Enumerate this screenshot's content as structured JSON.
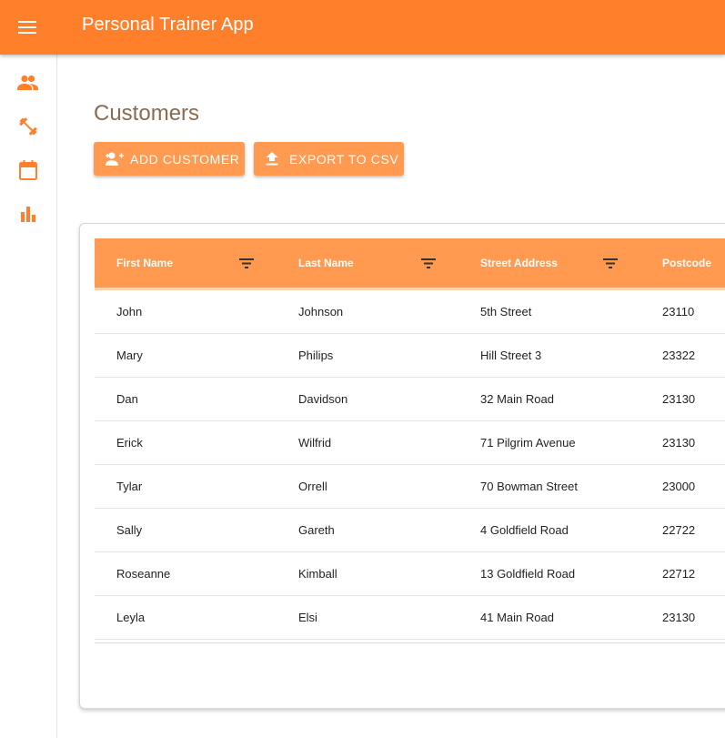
{
  "app": {
    "title": "Personal Trainer App"
  },
  "colors": {
    "accent": "#ff7f2a",
    "button": "#ff9a50",
    "title": "#8b6a52"
  },
  "appbar": {
    "menu_icon": "menu-icon"
  },
  "sidebar": {
    "items": [
      {
        "icon": "people-icon"
      },
      {
        "icon": "dumbbell-icon"
      },
      {
        "icon": "calendar-icon"
      },
      {
        "icon": "bar-chart-icon"
      }
    ]
  },
  "page": {
    "title": "Customers",
    "buttons": {
      "add_label": "ADD CUSTOMER",
      "export_label": "EXPORT TO CSV"
    }
  },
  "table": {
    "columns": [
      "First Name",
      "Last Name",
      "Street Address",
      "Postcode"
    ],
    "rows": [
      [
        "John",
        "Johnson",
        "5th Street",
        "23110"
      ],
      [
        "Mary",
        "Philips",
        "Hill Street 3",
        "23322"
      ],
      [
        "Dan",
        "Davidson",
        "32 Main Road",
        "23130"
      ],
      [
        "Erick",
        "Wilfrid",
        "71 Pilgrim Avenue",
        "23130"
      ],
      [
        "Tylar",
        "Orrell",
        "70 Bowman Street",
        "23000"
      ],
      [
        "Sally",
        "Gareth",
        "4 Goldfield Road",
        "22722"
      ],
      [
        "Roseanne",
        "Kimball",
        "13 Goldfield Road",
        "22712"
      ],
      [
        "Leyla",
        "Elsi",
        "41 Main Road",
        "23130"
      ]
    ]
  }
}
